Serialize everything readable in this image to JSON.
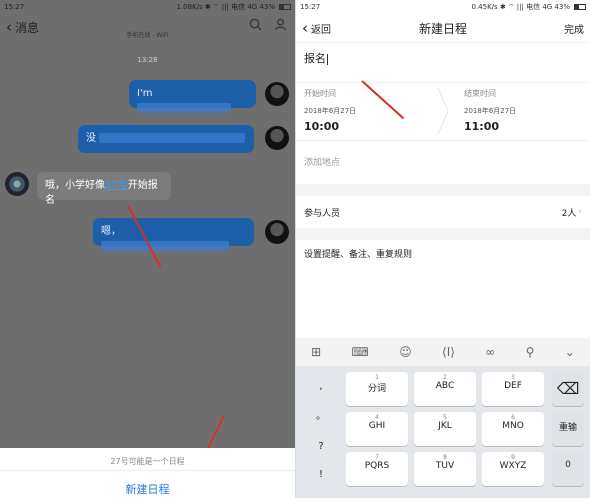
{
  "left": {
    "status": {
      "time": "15:27",
      "right": "1.08K/s  ✱  ⌔  ||| 电信 4G  43%"
    },
    "header": {
      "back_label": "消息",
      "contact_name": "...",
      "contact_sub": "手机在线 - WiFi"
    },
    "timestamp": "13:28",
    "messages": [
      {
        "side": "me",
        "text": "I'm"
      },
      {
        "side": "me",
        "text": "没"
      },
      {
        "side": "other",
        "text_before": "哦，小学好像",
        "link": "27号",
        "text_after": "开始报名"
      },
      {
        "side": "me",
        "text": "嗯，"
      }
    ],
    "sheet": {
      "hint": "27号可能是一个日程",
      "action": "新建日程"
    }
  },
  "right": {
    "status": {
      "time": "15:27",
      "right": "0.45K/s  ✱  ⌔  ||| 电信 4G  43%"
    },
    "header": {
      "back_label": "返回",
      "title": "新建日程",
      "done_label": "完成"
    },
    "title_value": "报名",
    "start": {
      "label": "开始时间",
      "date": "2018年6月27日",
      "time": "10:00"
    },
    "end": {
      "label": "结束时间",
      "date": "2018年6月27日",
      "time": "11:00"
    },
    "location_placeholder": "添加地点",
    "participants": {
      "label": "参与人员",
      "value": "2人"
    },
    "reminder": "设置提醒、备注、重复规则",
    "keyboard": {
      "left_col": [
        ",",
        "。",
        "?",
        "!"
      ],
      "row1": [
        {
          "num": "1",
          "let": "分词"
        },
        {
          "num": "2",
          "let": "ABC"
        },
        {
          "num": "3",
          "let": "DEF"
        }
      ],
      "row2": [
        {
          "num": "4",
          "let": "GHI"
        },
        {
          "num": "5",
          "let": "JKL"
        },
        {
          "num": "6",
          "let": "MNO"
        }
      ],
      "row3": [
        {
          "num": "7",
          "let": "PQRS"
        },
        {
          "num": "8",
          "let": "TUV"
        },
        {
          "num": "9",
          "let": "WXYZ"
        }
      ],
      "reenter": "重输",
      "zero": "0"
    },
    "accent_color": "#2a78d6"
  }
}
